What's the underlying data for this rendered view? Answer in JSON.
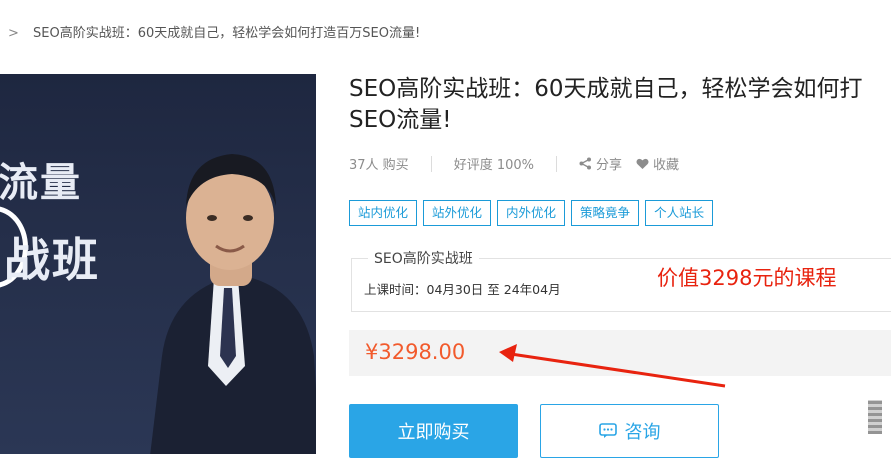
{
  "breadcrumb": {
    "separator": ">",
    "current": "SEO高阶实战班：60天成就自己，轻松学会如何打造百万SEO流量!"
  },
  "cover": {
    "line1": "流量",
    "line2": "战班"
  },
  "course": {
    "title_line1": "SEO高阶实战班：60天成就自己，轻松学会如何打",
    "title_line2": "SEO流量!",
    "buyers": "37人 购买",
    "rating": "好评度 100%",
    "share_label": "分享",
    "favorite_label": "收藏",
    "tags": [
      "站内优化",
      "站外优化",
      "内外优化",
      "策略竟争",
      "个人站长"
    ]
  },
  "schedule": {
    "name": "SEO高阶实战班",
    "time": "上课时间：04月30日 至 24年04月"
  },
  "annotation": {
    "value_note": "价值3298元的课程",
    "color": "#e8230f"
  },
  "price": {
    "amount": "¥3298.00",
    "color": "#f25a2c"
  },
  "actions": {
    "buy_label": "立即购买",
    "consult_label": "咨询",
    "accent": "#2aa5e6"
  },
  "icons": {
    "share": "share-icon",
    "favorite": "heart-icon",
    "consult": "chat-icon"
  }
}
